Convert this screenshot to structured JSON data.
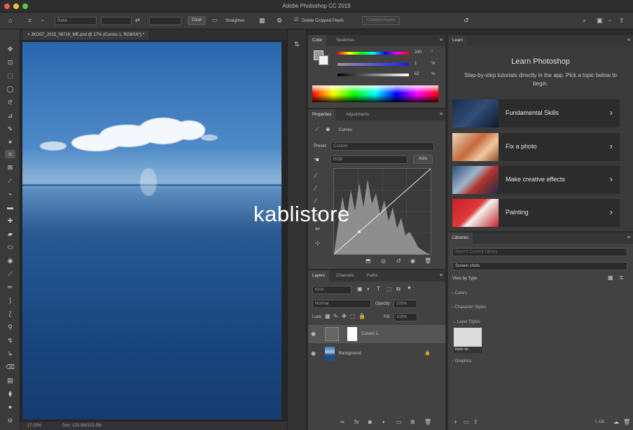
{
  "app": {
    "title": "Adobe Photoshop CC 2019"
  },
  "options_bar": {
    "ratio_label": "Ratio",
    "clear_label": "Clear",
    "straighten_label": "Straighten",
    "delete_cropped_label": "Delete Cropped Pixels",
    "content_aware_label": "Content-Aware"
  },
  "document": {
    "tab_title": "JKOST_2015_08716_ME.psd @ 17% (Curves 1, RGB/16*) *",
    "zoom": "17.02%",
    "doc_size": "Doc: 123.3M/123.3M"
  },
  "color_panel": {
    "tabs": [
      "Color",
      "Swatches"
    ],
    "h_value": "240",
    "h_unit": "°",
    "s_value": "1",
    "s_unit": "%",
    "b_value": "62",
    "b_unit": "%"
  },
  "properties_panel": {
    "tabs": [
      "Properties",
      "Adjustments"
    ],
    "adjustment_name": "Curves",
    "preset_label": "Preset:",
    "preset_value": "Custom",
    "channel_value": "RGB",
    "auto_label": "Auto"
  },
  "layers_panel": {
    "tabs": [
      "Layers",
      "Channels",
      "Paths"
    ],
    "filter_kind": "Kind",
    "blend_mode": "Normal",
    "opacity_label": "Opacity:",
    "opacity_value": "100%",
    "lock_label": "Lock:",
    "fill_label": "Fill:",
    "fill_value": "100%",
    "layers": [
      {
        "name": "Curves 1"
      },
      {
        "name": "Background"
      }
    ]
  },
  "learn_panel": {
    "tab": "Learn",
    "title": "Learn Photoshop",
    "description": "Step-by-step tutorials directly in the app. Pick a topic below to begin.",
    "cards": [
      {
        "label": "Fundamental Skills"
      },
      {
        "label": "Fix a photo"
      },
      {
        "label": "Make creative effects"
      },
      {
        "label": "Painting"
      }
    ]
  },
  "libraries_panel": {
    "tab": "Libraries",
    "search_placeholder": "Search Current Library",
    "library_name": "Screen shots",
    "view_by": "View by Type",
    "sections": [
      "Colors",
      "Character Styles",
      "Layer Styles",
      "Graphics"
    ],
    "style_thumb_label": "black str...",
    "size_label": "1 KB"
  },
  "watermark": "kablistore"
}
